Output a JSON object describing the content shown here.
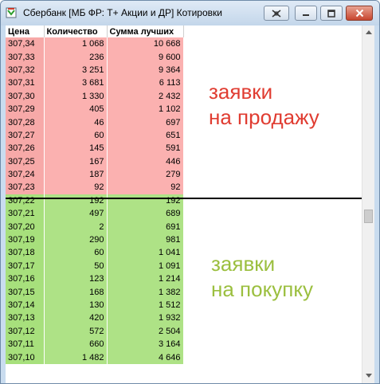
{
  "window": {
    "title": "Сбербанк [МБ ФР: Т+ Акции и ДР] Котировки",
    "icon": "quote-book-icon",
    "buttons": [
      "pin-icon",
      "minimize-icon",
      "maximize-icon",
      "close-icon"
    ]
  },
  "columns": {
    "price": "Цена",
    "quantity": "Количество",
    "sum": "Сумма лучших"
  },
  "sell_orders": [
    {
      "price": "307,34",
      "qty": "1 068",
      "sum": "10 668"
    },
    {
      "price": "307,33",
      "qty": "236",
      "sum": "9 600"
    },
    {
      "price": "307,32",
      "qty": "3 251",
      "sum": "9 364"
    },
    {
      "price": "307,31",
      "qty": "3 681",
      "sum": "6 113"
    },
    {
      "price": "307,30",
      "qty": "1 330",
      "sum": "2 432"
    },
    {
      "price": "307,29",
      "qty": "405",
      "sum": "1 102"
    },
    {
      "price": "307,28",
      "qty": "46",
      "sum": "697"
    },
    {
      "price": "307,27",
      "qty": "60",
      "sum": "651"
    },
    {
      "price": "307,26",
      "qty": "145",
      "sum": "591"
    },
    {
      "price": "307,25",
      "qty": "167",
      "sum": "446"
    },
    {
      "price": "307,24",
      "qty": "187",
      "sum": "279"
    },
    {
      "price": "307,23",
      "qty": "92",
      "sum": "92"
    }
  ],
  "buy_orders": [
    {
      "price": "307,22",
      "qty": "192",
      "sum": "192"
    },
    {
      "price": "307,21",
      "qty": "497",
      "sum": "689"
    },
    {
      "price": "307,20",
      "qty": "2",
      "sum": "691"
    },
    {
      "price": "307,19",
      "qty": "290",
      "sum": "981"
    },
    {
      "price": "307,18",
      "qty": "60",
      "sum": "1 041"
    },
    {
      "price": "307,17",
      "qty": "50",
      "sum": "1 091"
    },
    {
      "price": "307,16",
      "qty": "123",
      "sum": "1 214"
    },
    {
      "price": "307,15",
      "qty": "168",
      "sum": "1 382"
    },
    {
      "price": "307,14",
      "qty": "130",
      "sum": "1 512"
    },
    {
      "price": "307,13",
      "qty": "420",
      "sum": "1 932"
    },
    {
      "price": "307,12",
      "qty": "572",
      "sum": "2 504"
    },
    {
      "price": "307,11",
      "qty": "660",
      "sum": "3 164"
    },
    {
      "price": "307,10",
      "qty": "1 482",
      "sum": "4 646"
    }
  ],
  "annotations": {
    "sell": "заявки\nна продажу",
    "buy": "заявки\nна покупку"
  },
  "colors": {
    "sell_rows": "#f7a9a8",
    "buy_rows": "#a7e07c",
    "sell_note": "#e03c31",
    "buy_note": "#9bbf3f"
  },
  "scrollbar": {
    "up_icon": "scroll-up-arrow-icon",
    "down_icon": "scroll-down-arrow-icon"
  }
}
